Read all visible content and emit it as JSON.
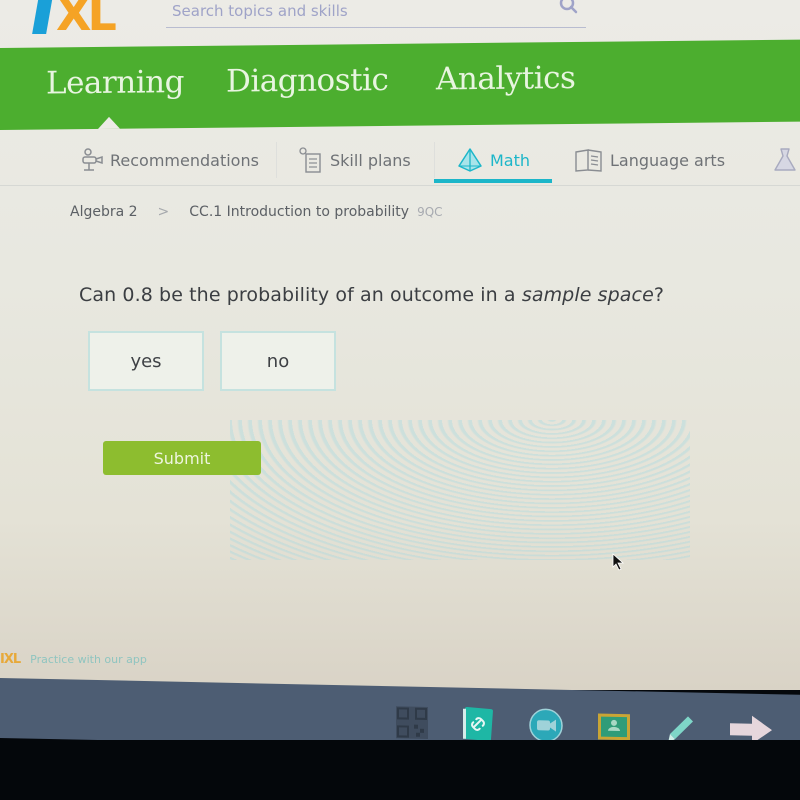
{
  "header": {
    "logo_text": "XL",
    "search_placeholder": "Search topics and skills"
  },
  "main_nav": {
    "items": [
      {
        "label": "Learning",
        "active": true
      },
      {
        "label": "Diagnostic",
        "active": false
      },
      {
        "label": "Analytics",
        "active": false
      }
    ]
  },
  "subject_tabs": {
    "items": [
      {
        "label": "Recommendations",
        "icon": "recommendations-icon",
        "active": false
      },
      {
        "label": "Skill plans",
        "icon": "skill-plans-icon",
        "active": false
      },
      {
        "label": "Math",
        "icon": "math-pyramid-icon",
        "active": true
      },
      {
        "label": "Language arts",
        "icon": "book-icon",
        "active": false
      },
      {
        "label": "",
        "icon": "science-flask-icon",
        "active": false
      }
    ],
    "accent_color": "#1cb6c9"
  },
  "breadcrumb": {
    "course": "Algebra 2",
    "separator": ">",
    "skill": "CC.1 Introduction to probability",
    "code": "9QC"
  },
  "question": {
    "text_before": "Can 0.8 be the probability of an outcome in a ",
    "text_italic": "sample space",
    "text_after": "?",
    "choices": [
      "yes",
      "no"
    ],
    "submit_label": "Submit"
  },
  "footer": {
    "app_logo": "IXL",
    "app_text": "Practice with our app"
  },
  "taskbar": {
    "icons": [
      "qr-code-icon",
      "link-notebook-icon",
      "video-camera-icon",
      "classroom-icon",
      "highlighter-icon",
      "arrow-right-icon"
    ]
  },
  "colors": {
    "brand_green": "#4cae2f",
    "submit_green": "#8dbd2f",
    "logo_blue": "#1aa0d8",
    "logo_orange": "#f5a325"
  }
}
